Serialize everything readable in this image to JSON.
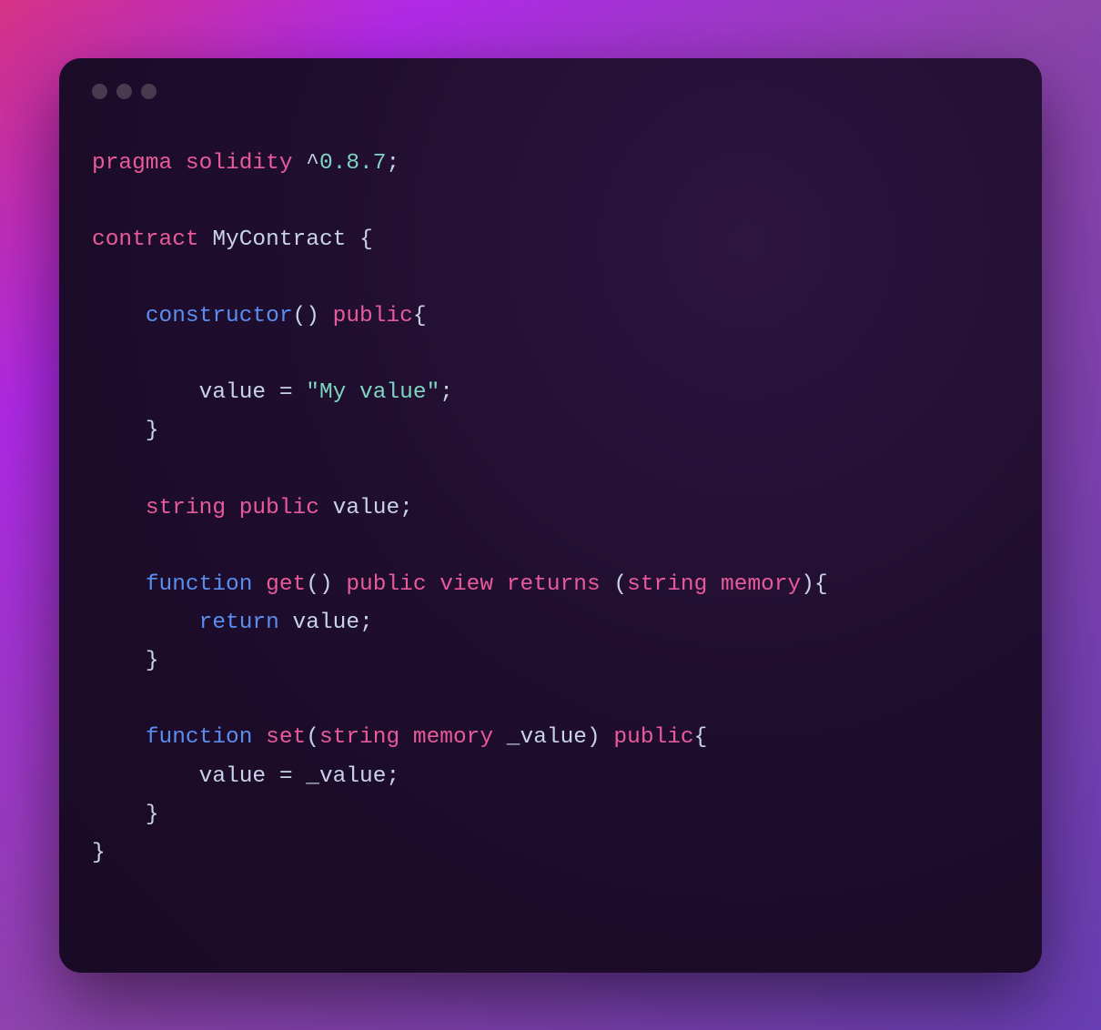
{
  "code": {
    "language": "solidity",
    "tokens": {
      "pragma": "pragma",
      "solidity": "solidity",
      "caret": "^",
      "version": "0.8.7",
      "semi": ";",
      "contract_kw": "contract",
      "contract_name": "MyContract",
      "lbrace": "{",
      "rbrace": "}",
      "constructor_kw": "constructor",
      "lparen": "(",
      "rparen": ")",
      "public_kw": "public",
      "value_ident": "value",
      "assign": "=",
      "string_literal": "\"My value\"",
      "string_kw": "string",
      "function_kw": "function",
      "get_fn": "get",
      "view_kw": "view",
      "returns_kw": "returns",
      "memory_kw": "memory",
      "return_kw": "return",
      "set_fn": "set",
      "param_value": "_value"
    }
  },
  "window": {
    "traffic_lights": 3
  }
}
